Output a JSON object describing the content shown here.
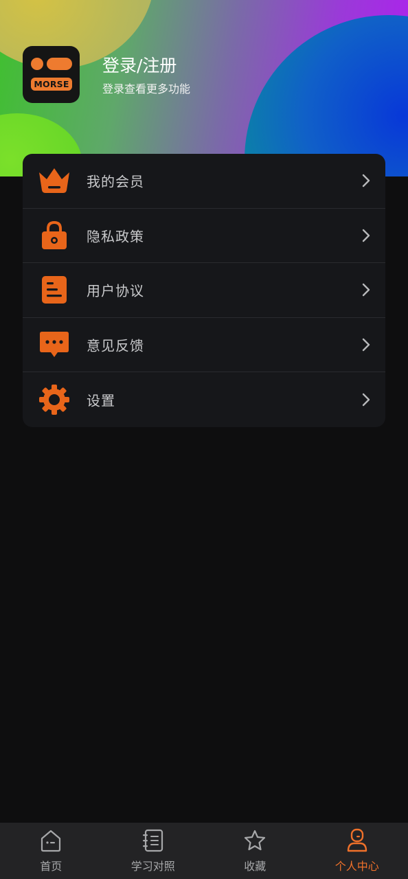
{
  "header": {
    "logo_badge_text": "MORSE",
    "login_title": "登录/注册",
    "login_subtitle": "登录查看更多功能"
  },
  "colors": {
    "accent": "#ee7b2f",
    "icon_orange": "#e8651a",
    "card_bg": "#16171a",
    "page_bg": "#0e0e0f",
    "nav_bg": "#232325",
    "nav_active": "#f0712a"
  },
  "menu": {
    "items": [
      {
        "icon": "crown-icon",
        "label": "我的会员"
      },
      {
        "icon": "lock-icon",
        "label": "隐私政策"
      },
      {
        "icon": "document-icon",
        "label": "用户协议"
      },
      {
        "icon": "chat-bubble-icon",
        "label": "意见反馈"
      },
      {
        "icon": "gear-icon",
        "label": "设置"
      }
    ]
  },
  "bottom_nav": {
    "active_index": 3,
    "items": [
      {
        "icon": "home-icon",
        "label": "首页"
      },
      {
        "icon": "notebook-icon",
        "label": "学习对照"
      },
      {
        "icon": "star-icon",
        "label": "收藏"
      },
      {
        "icon": "user-icon",
        "label": "个人中心"
      }
    ]
  }
}
